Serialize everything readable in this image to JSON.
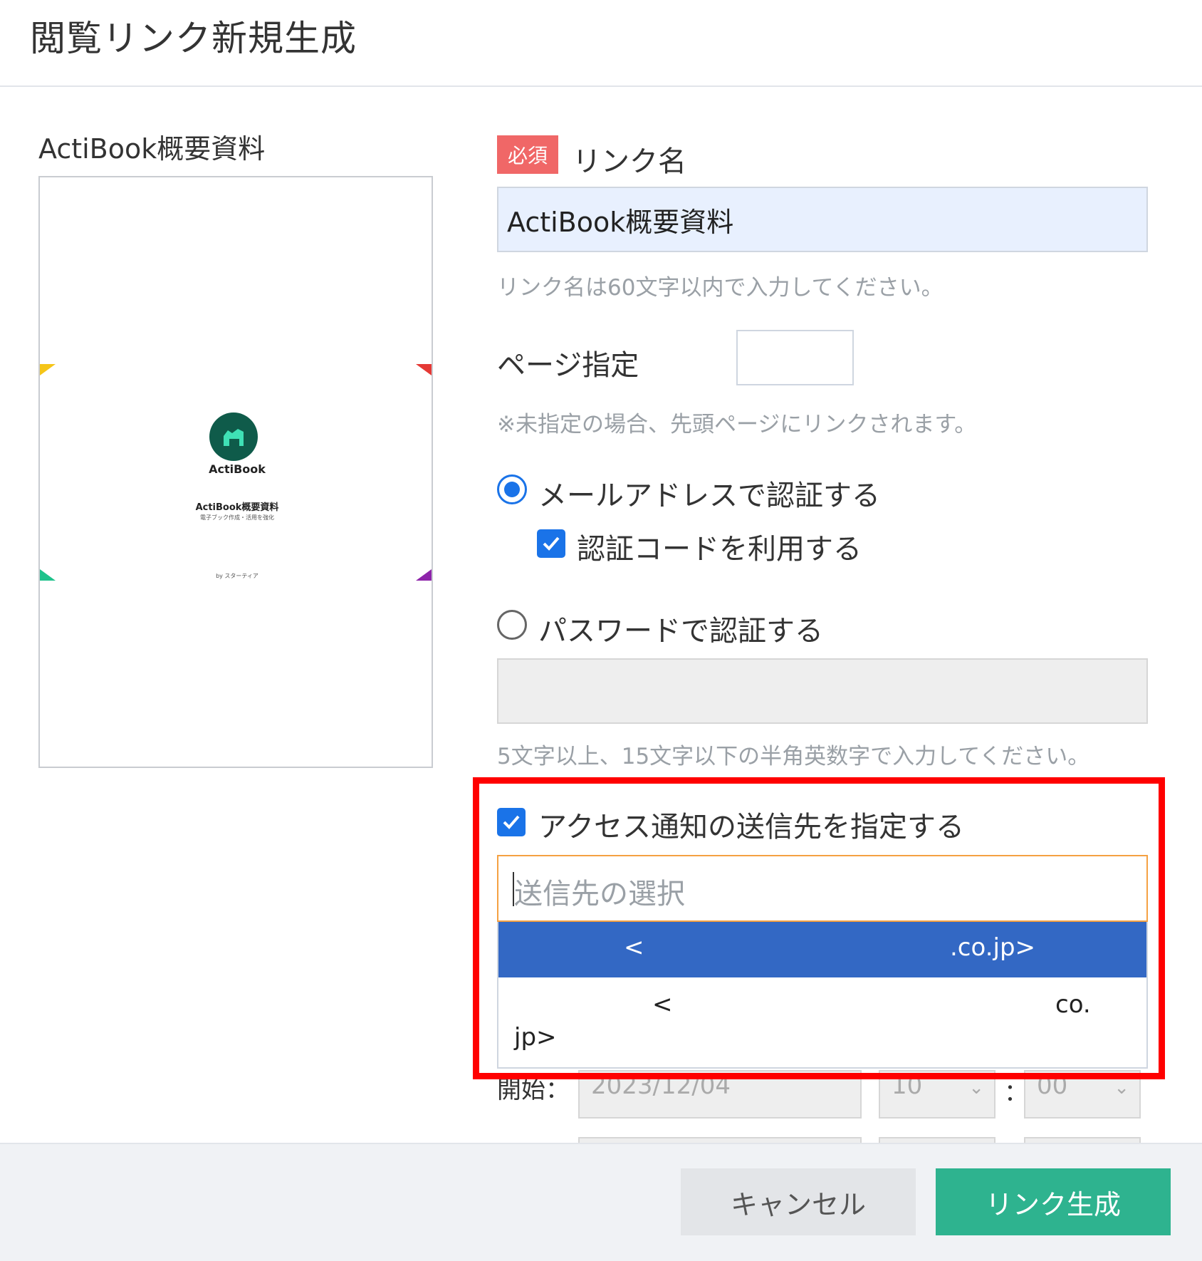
{
  "dialog": {
    "title": "閲覧リンク新規生成"
  },
  "document": {
    "title": "ActiBook概要資料",
    "cover": {
      "logo_text": "ActiBook",
      "title": "ActiBook概要資料",
      "subtitle": "電子ブック作成・活用を強化",
      "by": "by スターティア"
    }
  },
  "form": {
    "required_badge": "必須",
    "link_name_label": "リンク名",
    "link_name_value": "ActiBook概要資料",
    "link_name_hint": "リンク名は60文字以内で入力してください。",
    "page_label": "ページ指定",
    "page_value": "",
    "page_hint": "※未指定の場合、先頭ページにリンクされます。",
    "auth_email_label": "メールアドレスで認証する",
    "auth_email_checked": true,
    "use_code_label": "認証コードを利用する",
    "use_code_checked": true,
    "auth_password_label": "パスワードで認証する",
    "auth_password_checked": false,
    "password_value": "",
    "password_hint": "5文字以上、15文字以下の半角英数字で入力してください。",
    "notify_label": "アクセス通知の送信先を指定する",
    "notify_checked": true,
    "recipient_placeholder": "送信先の選択",
    "dropdown_options": [
      {
        "part_a": "<",
        "part_b": ".co.jp>",
        "highlighted": true
      },
      {
        "part_a": "<",
        "part_b": "co.",
        "part_c": "jp>",
        "highlighted": false
      }
    ],
    "period": {
      "start_label": "開始：",
      "start_date": "2023/12/04",
      "start_hour": "10",
      "start_minute": "00",
      "colon": "："
    }
  },
  "footer": {
    "cancel_label": "キャンセル",
    "create_label": "リンク生成"
  },
  "colors": {
    "accent_blue": "#1a73e8",
    "required_red": "#f06767",
    "create_green": "#2eb38f",
    "highlight_red": "#ff0000",
    "dropdown_selected": "#3368c4"
  }
}
